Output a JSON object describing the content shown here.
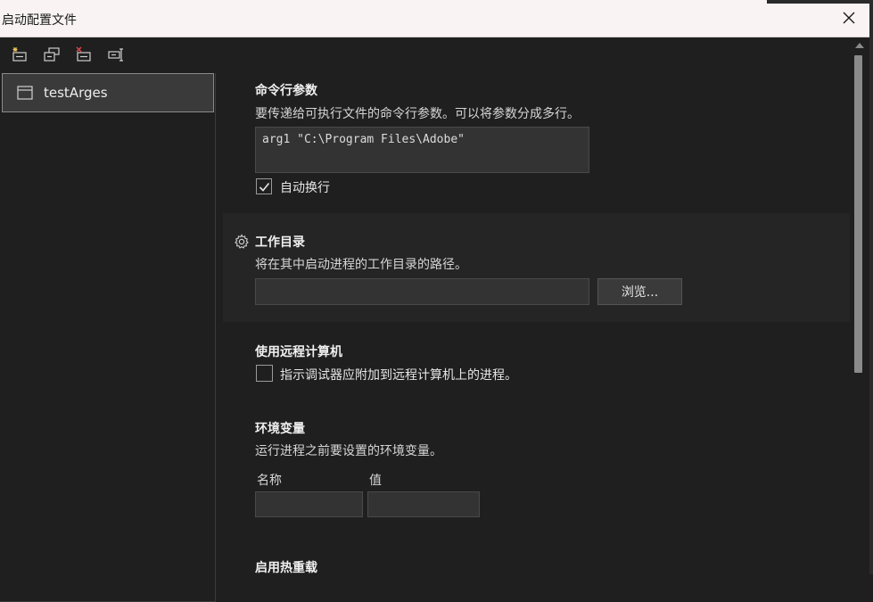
{
  "window": {
    "title": "启动配置文件"
  },
  "toolbar": {
    "buttons": [
      {
        "name": "new-profile",
        "icon": "new-profile-icon"
      },
      {
        "name": "copy-profile",
        "icon": "copy-profile-icon"
      },
      {
        "name": "delete-profile",
        "icon": "delete-profile-icon"
      },
      {
        "name": "rename-profile",
        "icon": "rename-profile-icon"
      }
    ]
  },
  "profiles": [
    {
      "label": "testArges",
      "selected": true
    }
  ],
  "command_args": {
    "title": "命令行参数",
    "description": "要传递给可执行文件的命令行参数。可以将参数分成多行。",
    "value": "arg1 \"C:\\Program Files\\Adobe\"",
    "wrap_label": "自动换行",
    "wrap_checked": true
  },
  "working_dir": {
    "title": "工作目录",
    "description": "将在其中启动进程的工作目录的路径。",
    "value": "",
    "browse_label": "浏览..."
  },
  "remote": {
    "title": "使用远程计算机",
    "checkbox_label": "指示调试器应附加到远程计算机上的进程。",
    "checked": false
  },
  "env": {
    "title": "环境变量",
    "description": "运行进程之前要设置的环境变量。",
    "col_name": "名称",
    "col_value": "值"
  },
  "hot_reload": {
    "title": "启用热重载"
  },
  "colors": {
    "background": "#1f1f1f",
    "highlight_section": "#252526",
    "titlebar": "#f9f3f3"
  }
}
